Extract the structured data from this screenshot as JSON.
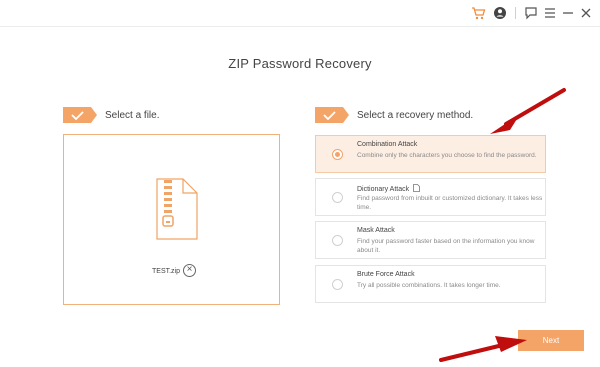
{
  "colors": {
    "accent": "#f5a468",
    "arrow": "#c00d0d",
    "selected_bg": "#fdeee3"
  },
  "titlebar": {
    "icons": [
      "cart-icon",
      "account-icon",
      "feedback-icon",
      "menu-icon",
      "minimize-icon",
      "close-icon"
    ]
  },
  "app_title": "ZIP Password Recovery",
  "file_section": {
    "label": "Select a file.",
    "file_name": "TEST.zip",
    "remove_label": "×"
  },
  "method_section": {
    "label": "Select a recovery method.",
    "methods": [
      {
        "title": "Combination Attack",
        "description": "Combine only the characters you choose to find the password.",
        "selected": true
      },
      {
        "title": "Dictionary Attack",
        "description": "Find password from inbuilt or customized dictionary. It takes less time.",
        "selected": false
      },
      {
        "title": "Mask Attack",
        "description": "Find your password faster based on the information you know about it.",
        "selected": false
      },
      {
        "title": "Brute Force Attack",
        "description": "Try all possible combinations. It takes longer time.",
        "selected": false
      }
    ]
  },
  "next_label": "Next"
}
